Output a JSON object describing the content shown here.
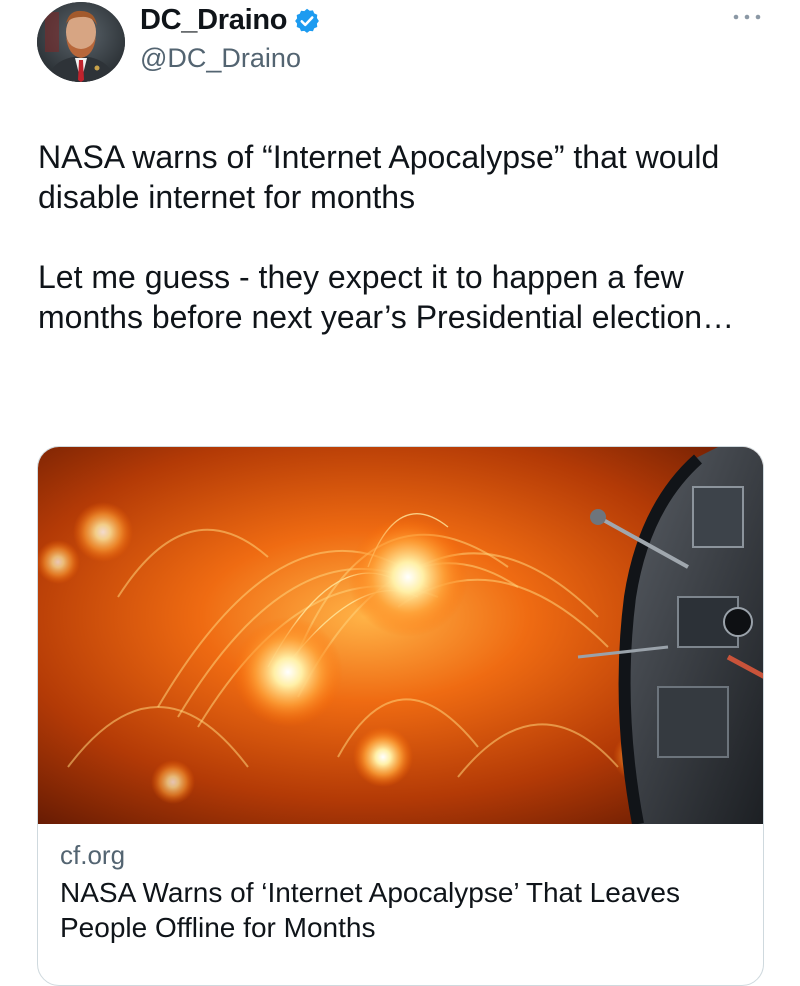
{
  "author": {
    "display_name": "DC_Draino",
    "handle": "@DC_Draino",
    "verified": true,
    "verified_color": "#1d9bf0"
  },
  "tweet": {
    "paragraphs": [
      "NASA warns of “Internet Apocalypse” that would disable internet for months",
      "Let me guess - they expect it to happen a few months before next year’s Presidential election…"
    ]
  },
  "link_card": {
    "domain": "cf.org",
    "title": "NASA Warns of ‘Internet Apocalypse’ That Leaves People Offline for Months",
    "image": "solar-flare-with-spacecraft"
  },
  "icons": {
    "more": "more-options-icon",
    "verified": "verified-badge-icon"
  },
  "colors": {
    "text_primary": "#0f1419",
    "text_secondary": "#536471",
    "card_border": "#cfd9de"
  }
}
